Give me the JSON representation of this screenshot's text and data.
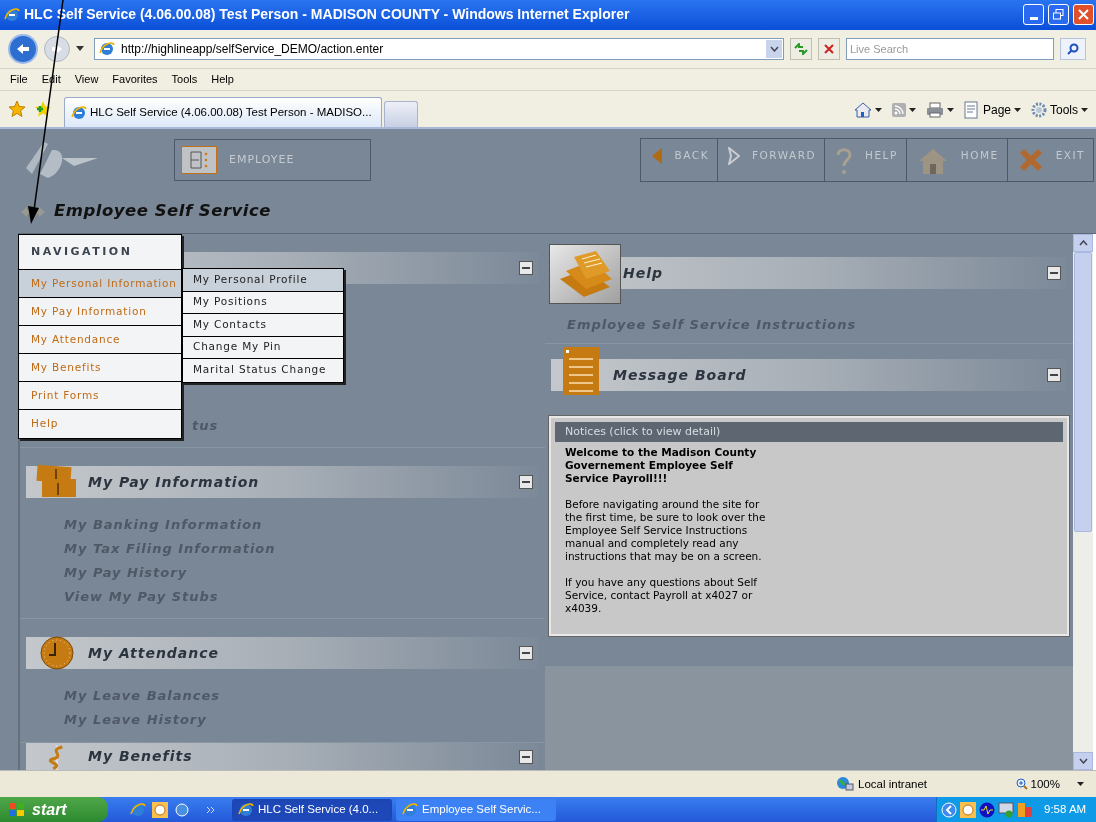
{
  "window": {
    "title": "HLC Self Service (4.06.00.08) Test Person - MADISON COUNTY - Windows Internet Explorer"
  },
  "address_bar": {
    "url": "http://highlineapp/selfService_DEMO/action.enter",
    "search_placeholder": "Live Search"
  },
  "menu_bar": [
    "File",
    "Edit",
    "View",
    "Favorites",
    "Tools",
    "Help"
  ],
  "tabs": [
    {
      "label": "HLC Self Service (4.06.00.08) Test Person - MADISO...",
      "selected": true
    }
  ],
  "command_bar": [
    {
      "kind": "home"
    },
    {
      "kind": "feeds"
    },
    {
      "kind": "print"
    },
    {
      "kind": "page",
      "label": "Page"
    },
    {
      "kind": "tools",
      "label": "Tools"
    }
  ],
  "app": {
    "module": "EMPLOYEE",
    "page_title": "Employee Self Service",
    "nav_buttons": [
      {
        "kind": "back",
        "label": "BACK"
      },
      {
        "kind": "forward",
        "label": "FORWARD"
      },
      {
        "kind": "help",
        "label": "HELP"
      },
      {
        "kind": "home",
        "label": "HOME"
      },
      {
        "kind": "exit",
        "label": "EXIT"
      }
    ]
  },
  "navigation_menu": {
    "title": "NAVIGATION",
    "items": [
      {
        "label": "My Personal Information",
        "selected": true
      },
      {
        "label": "My Pay Information",
        "selected": false
      },
      {
        "label": "My Attendance",
        "selected": false
      },
      {
        "label": "My Benefits",
        "selected": false
      },
      {
        "label": "Print Forms",
        "selected": false
      },
      {
        "label": "Help",
        "selected": false
      }
    ],
    "submenu": [
      {
        "label": "My Personal Profile",
        "selected": true
      },
      {
        "label": "My Positions",
        "selected": false
      },
      {
        "label": "My Contacts",
        "selected": false
      },
      {
        "label": "Change My Pin",
        "selected": false
      },
      {
        "label": "Marital Status Change",
        "selected": false
      }
    ]
  },
  "left_sections": [
    {
      "kind": "personal",
      "links": [
        "tus"
      ]
    },
    {
      "kind": "pay",
      "title": "My Pay Information",
      "links": [
        "My Banking Information",
        "My Tax Filing Information",
        "My Pay History",
        "View My Pay Stubs"
      ]
    },
    {
      "kind": "attendance",
      "title": "My Attendance",
      "links": [
        "My Leave Balances",
        "My Leave History"
      ]
    },
    {
      "kind": "benefits",
      "title": "My Benefits"
    }
  ],
  "help_section": {
    "title": "Help",
    "links": [
      "Employee Self Service Instructions"
    ]
  },
  "message_board": {
    "title": "Message Board",
    "notices_header": "Notices (click to view detail)",
    "heading": "Welcome to the Madison County Governement Employee Self Service Payroll!!!",
    "paragraphs": [
      "Before navigating around the site for the first time, be sure to look over the Employee Self Service Instructions manual and completely read any instructions that may be on a screen.",
      "If you have any questions about Self Service, contact Payroll at x4027 or x4039."
    ]
  },
  "status_bar": {
    "zone": "Local intranet",
    "zoom": "100%"
  },
  "taskbar": {
    "start": "start",
    "tasks": [
      {
        "label": "HLC Self Service (4.0...",
        "selected": true
      },
      {
        "label": "Employee Self Servic...",
        "selected": false
      }
    ],
    "clock": "9:58 AM"
  }
}
